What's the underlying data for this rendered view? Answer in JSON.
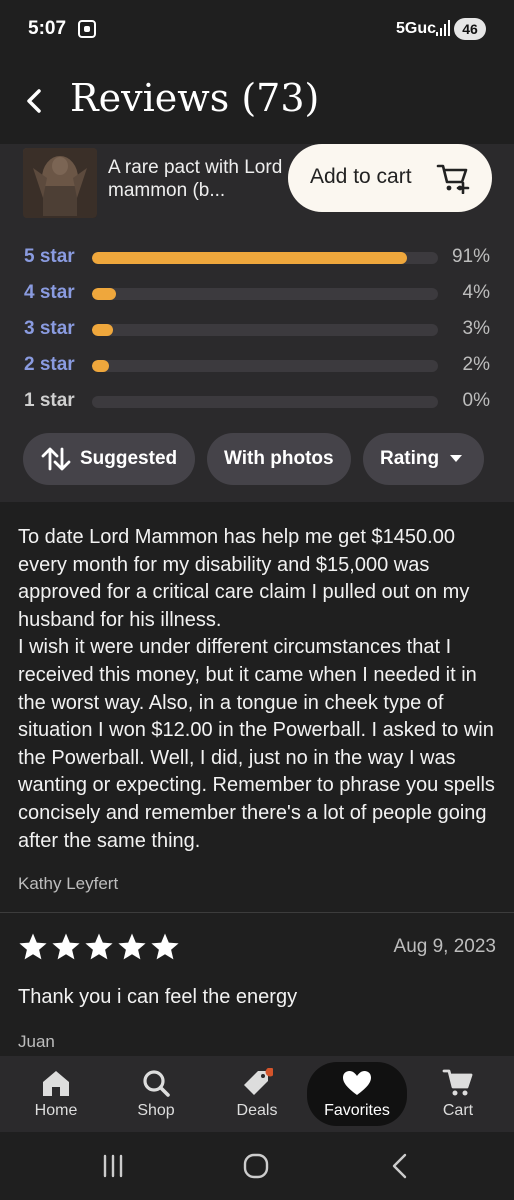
{
  "status_bar": {
    "time": "5:07",
    "network": "5Guc",
    "battery": "46"
  },
  "header": {
    "title": "Reviews (73)"
  },
  "product": {
    "name": "A rare pact with Lord mammon (b...",
    "add_to_cart_label": "Add to cart"
  },
  "ratings": [
    {
      "label": "5 star",
      "pct": "91%",
      "fraction": 0.91
    },
    {
      "label": "4 star",
      "pct": "4%",
      "fraction": 0.07
    },
    {
      "label": "3 star",
      "pct": "3%",
      "fraction": 0.06
    },
    {
      "label": "2 star",
      "pct": "2%",
      "fraction": 0.05
    },
    {
      "label": "1 star",
      "pct": "0%",
      "fraction": 0
    }
  ],
  "filters": {
    "suggested": "Suggested",
    "with_photos": "With photos",
    "rating": "Rating"
  },
  "reviews": [
    {
      "paragraphs": [
        "To date Lord Mammon has help me get $1450.00 every month for my disability and $15,000 was approved for a critical care claim I pulled out on my husband for his illness.",
        "I wish it were under different circumstances that I received this money, but it came when I needed it in the worst way. Also, in a tongue in cheek type of situation I won $12.00 in the Powerball. I asked to win the Powerball. Well, I did, just no in the way I was wanting or expecting. Remember to phrase you spells concisely and remember there's a lot of people going after the same thing."
      ],
      "author": "Kathy Leyfert"
    },
    {
      "stars": 5,
      "date": "Aug 9, 2023",
      "text": "Thank you i can feel the energy",
      "author": "Juan"
    }
  ],
  "bottom_nav": [
    {
      "label": "Home",
      "icon": "home-icon"
    },
    {
      "label": "Shop",
      "icon": "search-icon"
    },
    {
      "label": "Deals",
      "icon": "tag-icon"
    },
    {
      "label": "Favorites",
      "icon": "heart-icon"
    },
    {
      "label": "Cart",
      "icon": "cart-icon"
    }
  ],
  "colors": {
    "accent": "#efa73c",
    "star_label": "#8a9be0",
    "background": "#1f1f1f",
    "panel": "#2b2a2c"
  }
}
